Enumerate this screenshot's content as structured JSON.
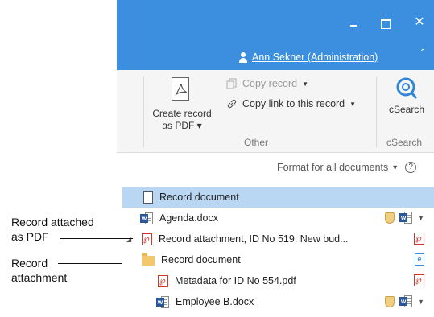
{
  "window": {
    "minimize_icon": "minimize-icon",
    "maximize_icon": "maximize-icon",
    "close_label": "✕",
    "user_name": "Ann Sekner (Administration)",
    "collapse_label": "⌃"
  },
  "ribbon": {
    "create_pdf_line1": "Create record",
    "create_pdf_line2": "as PDF ▾",
    "copy_record": "Copy record",
    "copy_link": "Copy link to this record",
    "group_other": "Other",
    "csearch_button": "cSearch",
    "group_csearch": "cSearch"
  },
  "format_bar": {
    "label": "Format for all documents",
    "help": "?"
  },
  "tree": [
    {
      "label": "Record document",
      "icon": "document-icon",
      "selected": true
    },
    {
      "label": "Agenda.docx",
      "icon": "word-icon"
    },
    {
      "label": "Record attachment, ID No 519: New bud...",
      "icon": "pdf-icon"
    },
    {
      "label": "Record document",
      "icon": "folder-icon"
    },
    {
      "label": "Metadata for ID No 554.pdf",
      "icon": "pdf-icon"
    },
    {
      "label": "Employee B.docx",
      "icon": "word-icon"
    }
  ],
  "annotations": {
    "pdf_line1": "Record attached",
    "pdf_line2": "as PDF",
    "attach_line1": "Record",
    "attach_line2": "attachment"
  },
  "colors": {
    "titlebar": "#3c8fde",
    "selection": "#b9d7f3",
    "pdf_red": "#d1362a"
  }
}
